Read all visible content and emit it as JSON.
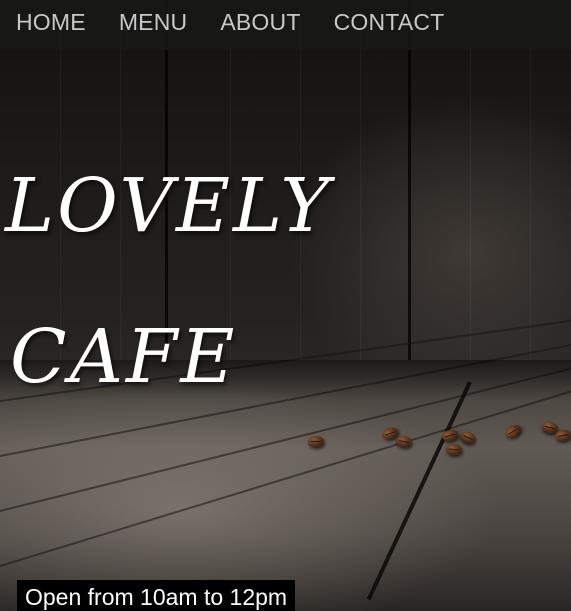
{
  "nav": {
    "items": [
      {
        "label": "HOME"
      },
      {
        "label": "MENU"
      },
      {
        "label": "ABOUT"
      },
      {
        "label": "CONTACT"
      }
    ]
  },
  "hero": {
    "title_line_1": "LOVELY",
    "title_line_2": "CAFE"
  },
  "hours": {
    "text": "Open from 10am to 12pm"
  },
  "colors": {
    "nav_text": "#c8c8c8",
    "title_text": "#ffffff",
    "badge_background": "#000000",
    "badge_text": "#ffffff"
  },
  "background": {
    "scene": "dark wooden wall and rustic wooden table with scattered coffee beans"
  }
}
